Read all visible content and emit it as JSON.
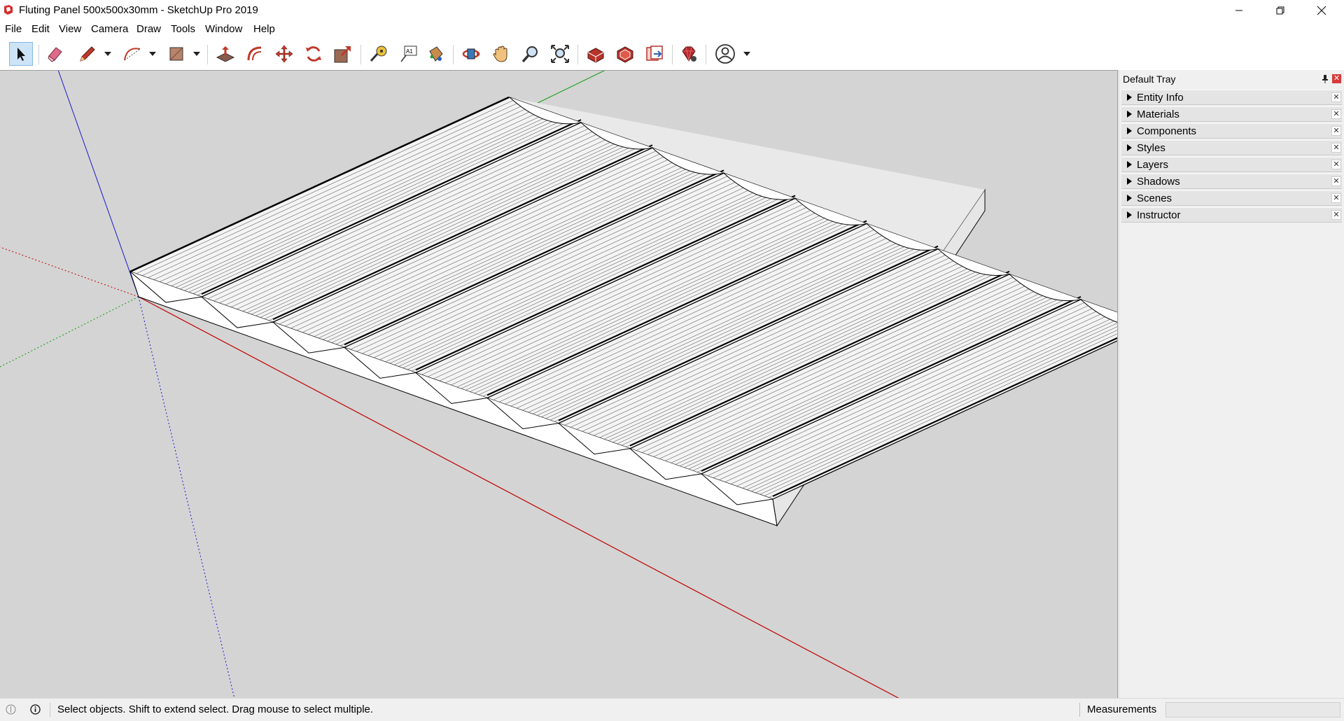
{
  "window": {
    "title": "Fluting Panel 500x500x30mm - SketchUp Pro 2019",
    "app_icon": "sketchup-logo-icon",
    "controls": [
      "minimize-icon",
      "restore-icon",
      "close-icon"
    ]
  },
  "menu": [
    {
      "label": "File"
    },
    {
      "label": "Edit"
    },
    {
      "label": "View"
    },
    {
      "label": "Camera"
    },
    {
      "label": "Draw"
    },
    {
      "label": "Tools"
    },
    {
      "label": "Window"
    },
    {
      "label": "Help"
    }
  ],
  "toolbar": {
    "tools": [
      {
        "icon": "select-arrow-icon",
        "active": true
      },
      {
        "icon": "eraser-icon"
      },
      {
        "icon": "pencil-line-icon",
        "dropdown": true
      },
      {
        "icon": "arc-icon",
        "dropdown": true
      },
      {
        "icon": "rectangle-icon",
        "dropdown": true
      },
      {
        "icon": "push-pull-icon"
      },
      {
        "icon": "offset-icon"
      },
      {
        "icon": "move-icon"
      },
      {
        "icon": "rotate-icon"
      },
      {
        "icon": "scale-icon"
      },
      {
        "icon": "tape-measure-icon"
      },
      {
        "icon": "text-icon"
      },
      {
        "icon": "paint-bucket-icon"
      },
      {
        "icon": "orbit-icon"
      },
      {
        "icon": "pan-hand-icon"
      },
      {
        "icon": "zoom-icon"
      },
      {
        "icon": "zoom-extents-icon"
      },
      {
        "icon": "3d-warehouse-icon"
      },
      {
        "icon": "extension-warehouse-icon"
      },
      {
        "icon": "layout-send-icon"
      },
      {
        "icon": "extension-manager-ruby-icon"
      },
      {
        "icon": "user-account-icon",
        "dropdown": true
      }
    ]
  },
  "tray": {
    "title": "Default Tray",
    "panels": [
      {
        "label": "Entity Info"
      },
      {
        "label": "Materials"
      },
      {
        "label": "Components"
      },
      {
        "label": "Styles"
      },
      {
        "label": "Layers"
      },
      {
        "label": "Shadows"
      },
      {
        "label": "Scenes"
      },
      {
        "label": "Instructor"
      }
    ]
  },
  "status": {
    "text": "Select objects. Shift to extend select. Drag mouse to select multiple.",
    "measurements_label": "Measurements",
    "measurements_value": ""
  },
  "model": {
    "flute_count": 9,
    "colors": {
      "background": "#d4d4d4",
      "red_axis": "#c00000",
      "green_axis": "#0a9a0a",
      "blue_axis": "#1a1acc",
      "edges": "#000000"
    }
  }
}
